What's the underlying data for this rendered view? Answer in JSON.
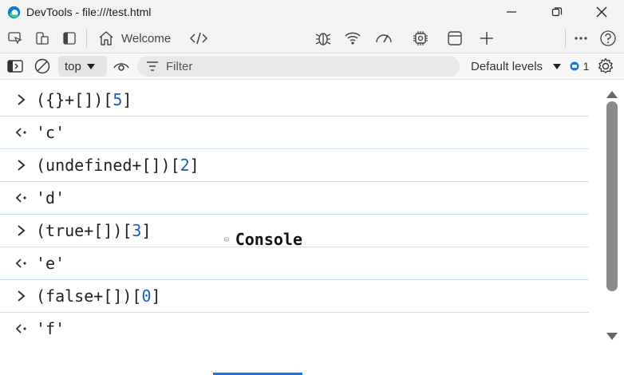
{
  "window": {
    "title": "DevTools - file:///test.html"
  },
  "tabs": {
    "welcome": "Welcome",
    "console": "Console"
  },
  "toolbar": {
    "context": "top",
    "filter_placeholder": "Filter",
    "levels": "Default levels",
    "issues_count": "1"
  },
  "console_rows": [
    {
      "type": "input",
      "parts": [
        "({}+[])[",
        "5",
        "]"
      ]
    },
    {
      "type": "output",
      "value": "'c'"
    },
    {
      "type": "input",
      "parts": [
        "(undefined+[])[",
        "2",
        "]"
      ]
    },
    {
      "type": "output",
      "value": "'d'"
    },
    {
      "type": "input",
      "parts": [
        "(true+[])[",
        "3",
        "]"
      ]
    },
    {
      "type": "output",
      "value": "'e'"
    },
    {
      "type": "input",
      "parts": [
        "(false+[])[",
        "0",
        "]"
      ]
    },
    {
      "type": "output",
      "value": "'f'"
    }
  ],
  "colors": {
    "accent": "#1a73e8",
    "string": "#b4247d",
    "number": "#1a5fb4"
  }
}
